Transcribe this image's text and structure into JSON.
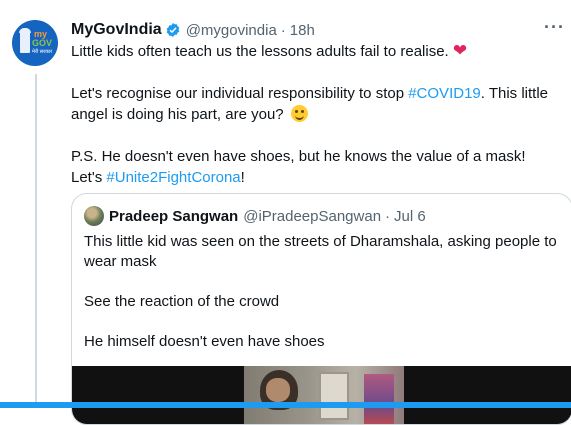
{
  "tweet": {
    "display_name": "MyGovIndia",
    "handle": "@mygovindia",
    "separator": "·",
    "time": "18h",
    "avatar": {
      "line1": "my",
      "line2": "GOV",
      "line3": "मेरी सरकार"
    },
    "paragraphs": {
      "p1": {
        "text": "Little kids often teach us the lessons adults fail to realise.",
        "emoji": "❤"
      },
      "p2": {
        "text_a": "Let's recognise our individual responsibility to stop ",
        "hashtag": "#COVID19",
        "text_b": ". This little angel is doing his part, are you?"
      },
      "p3": {
        "line1": "P.S. He doesn't even have shoes, but he knows the value of a mask!",
        "text_a": "Let's ",
        "hashtag": "#Unite2FightCorona",
        "text_b": "!"
      }
    }
  },
  "quote": {
    "display_name": "Pradeep Sangwan",
    "handle": "@iPradeepSangwan",
    "separator": "·",
    "time": "Jul 6",
    "paragraphs": [
      "This little kid was seen on the streets of Dharamshala, asking people to wear mask",
      "See the reaction of the crowd",
      "He himself doesn't even have shoes"
    ]
  },
  "colors": {
    "accent": "#1d9bf0",
    "text": "#0f1419",
    "muted": "#536471",
    "heart": "#e0245e",
    "border": "#cfd9de"
  },
  "icons": [
    "verified-icon",
    "more-icon",
    "heart-emoji",
    "smile-emoji"
  ]
}
